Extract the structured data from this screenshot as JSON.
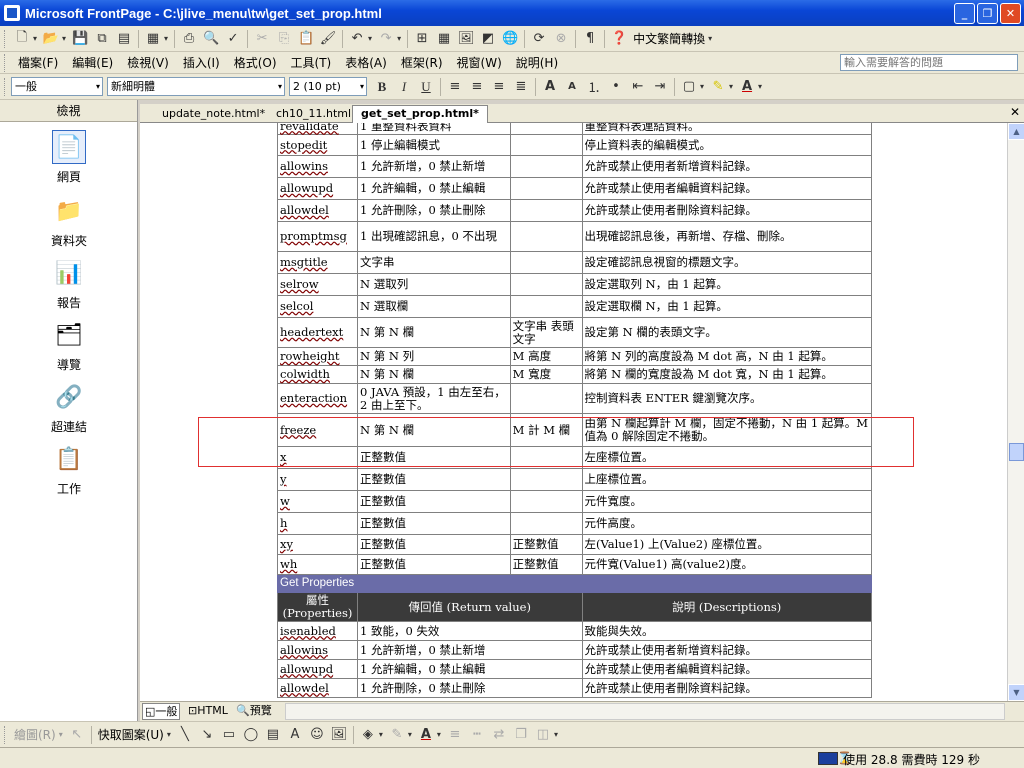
{
  "window": {
    "title": "Microsoft FrontPage - C:\\jlive_menu\\tw\\get_set_prop.html",
    "min": "_",
    "max": "❐",
    "close": "✕"
  },
  "toolbar1": {
    "translate_label": "中文繁簡轉換"
  },
  "menubar": {
    "items": [
      "檔案(F)",
      "編輯(E)",
      "檢視(V)",
      "插入(I)",
      "格式(O)",
      "工具(T)",
      "表格(A)",
      "框架(R)",
      "視窗(W)",
      "說明(H)"
    ],
    "help_placeholder": "輸入需要解答的問題"
  },
  "formatbar": {
    "style": "一般",
    "font": "新細明體",
    "size": "2  (10 pt)",
    "bold": "B",
    "italic": "I",
    "underline": "U"
  },
  "views": {
    "title": "檢視",
    "items": [
      "網頁",
      "資料夾",
      "報告",
      "導覽",
      "超連結",
      "工作"
    ]
  },
  "tabs": [
    "update_note.html*",
    "ch10_11.html",
    "get_set_prop.html*"
  ],
  "table": {
    "rows": [
      {
        "prop": "revalidate",
        "val": "1 重整資料表資料",
        "type": "",
        "desc": "重整資料表連結資料。"
      },
      {
        "prop": "stopedit",
        "val": "1 停止編輯模式",
        "type": "",
        "desc": "停止資料表的編輯模式。"
      },
      {
        "prop": "allowins",
        "val": "1 允許新增，0 禁止新增",
        "type": "",
        "desc": "允許或禁止使用者新增資料記錄。"
      },
      {
        "prop": "allowupd",
        "val": "1 允許編輯，0 禁止編輯",
        "type": "",
        "desc": "允許或禁止使用者編輯資料記錄。"
      },
      {
        "prop": "allowdel",
        "val": "1 允許刪除，0 禁止刪除",
        "type": "",
        "desc": "允許或禁止使用者刪除資料記錄。"
      },
      {
        "prop": "promptmsg",
        "val": "1 出現確認訊息，0 不出現",
        "type": "",
        "desc": "出現確認訊息後，再新增、存檔、刪除。"
      },
      {
        "prop": "msgtitle",
        "val": "文字串",
        "type": "",
        "desc": "設定確認訊息視窗的標題文字。"
      },
      {
        "prop": "selrow",
        "val": "N 選取列",
        "type": "",
        "desc": "設定選取列 N，由 1 起算。"
      },
      {
        "prop": "selcol",
        "val": "N 選取欄",
        "type": "",
        "desc": "設定選取欄 N，由 1 起算。"
      },
      {
        "prop": "headertext",
        "val": "N 第 N 欄",
        "type": "文字串 表頭文字",
        "desc": "設定第 N 欄的表頭文字。"
      },
      {
        "prop": "rowheight",
        "val": "N 第 N 列",
        "type": "M 高度",
        "desc": "將第 N 列的高度設為 M dot 高，N 由 1 起算。"
      },
      {
        "prop": "colwidth",
        "val": "N 第 N 欄",
        "type": "M 寬度",
        "desc": "將第 N 欄的寬度設為 M dot 寬，N 由 1 起算。"
      },
      {
        "prop": "enteraction",
        "val": "0 JAVA 預設，1 由左至右，2 由上至下。",
        "type": "",
        "desc": "控制資料表 ENTER 鍵瀏覽次序。"
      },
      {
        "prop": "freeze",
        "val": "N 第 N 欄",
        "type": "M 計 M 欄",
        "desc": "由第 N 欄起算計 M 欄，固定不捲動，N 由 1 起算。M 值為 0 解除固定不捲動。"
      },
      {
        "prop": "x",
        "val": "正整數值",
        "type": "",
        "desc": "左座標位置。"
      },
      {
        "prop": "y",
        "val": "正整數值",
        "type": "",
        "desc": "上座標位置。"
      },
      {
        "prop": "w",
        "val": "正整數值",
        "type": "",
        "desc": "元件寬度。"
      },
      {
        "prop": "h",
        "val": "正整數值",
        "type": "",
        "desc": "元件高度。"
      },
      {
        "prop": "xy",
        "val": "正整數值",
        "type": "正整數值",
        "desc": "左(Value1) 上(Value2) 座標位置。"
      },
      {
        "prop": "wh",
        "val": "正整數值",
        "type": "正整數值",
        "desc": "元件寬(Value1) 高(value2)度。"
      }
    ],
    "section_title": "Get Properties",
    "headers": [
      "屬性 (Properties)",
      "傳回值 (Return value)",
      "說明 (Descriptions)"
    ],
    "get_rows": [
      {
        "prop": "isenabled",
        "val": "1 致能，0 失效",
        "desc": "致能與失效。"
      },
      {
        "prop": "allowins",
        "val": "1 允許新增，0 禁止新增",
        "desc": "允許或禁止使用者新增資料記錄。"
      },
      {
        "prop": "allowupd",
        "val": "1 允許編輯，0 禁止編輯",
        "desc": "允許或禁止使用者編輯資料記錄。"
      },
      {
        "prop": "allowdel",
        "val": "1 允許刪除，0 禁止刪除",
        "desc": "允許或禁止使用者刪除資料記錄。"
      }
    ]
  },
  "viewtabs": [
    "一般",
    "HTML",
    "預覽"
  ],
  "drawbar": {
    "draw_label": "繪圖(R)",
    "autoshapes_label": "快取圖案(U)"
  },
  "status": {
    "text": "使用 28.8 需費時 129 秒"
  }
}
